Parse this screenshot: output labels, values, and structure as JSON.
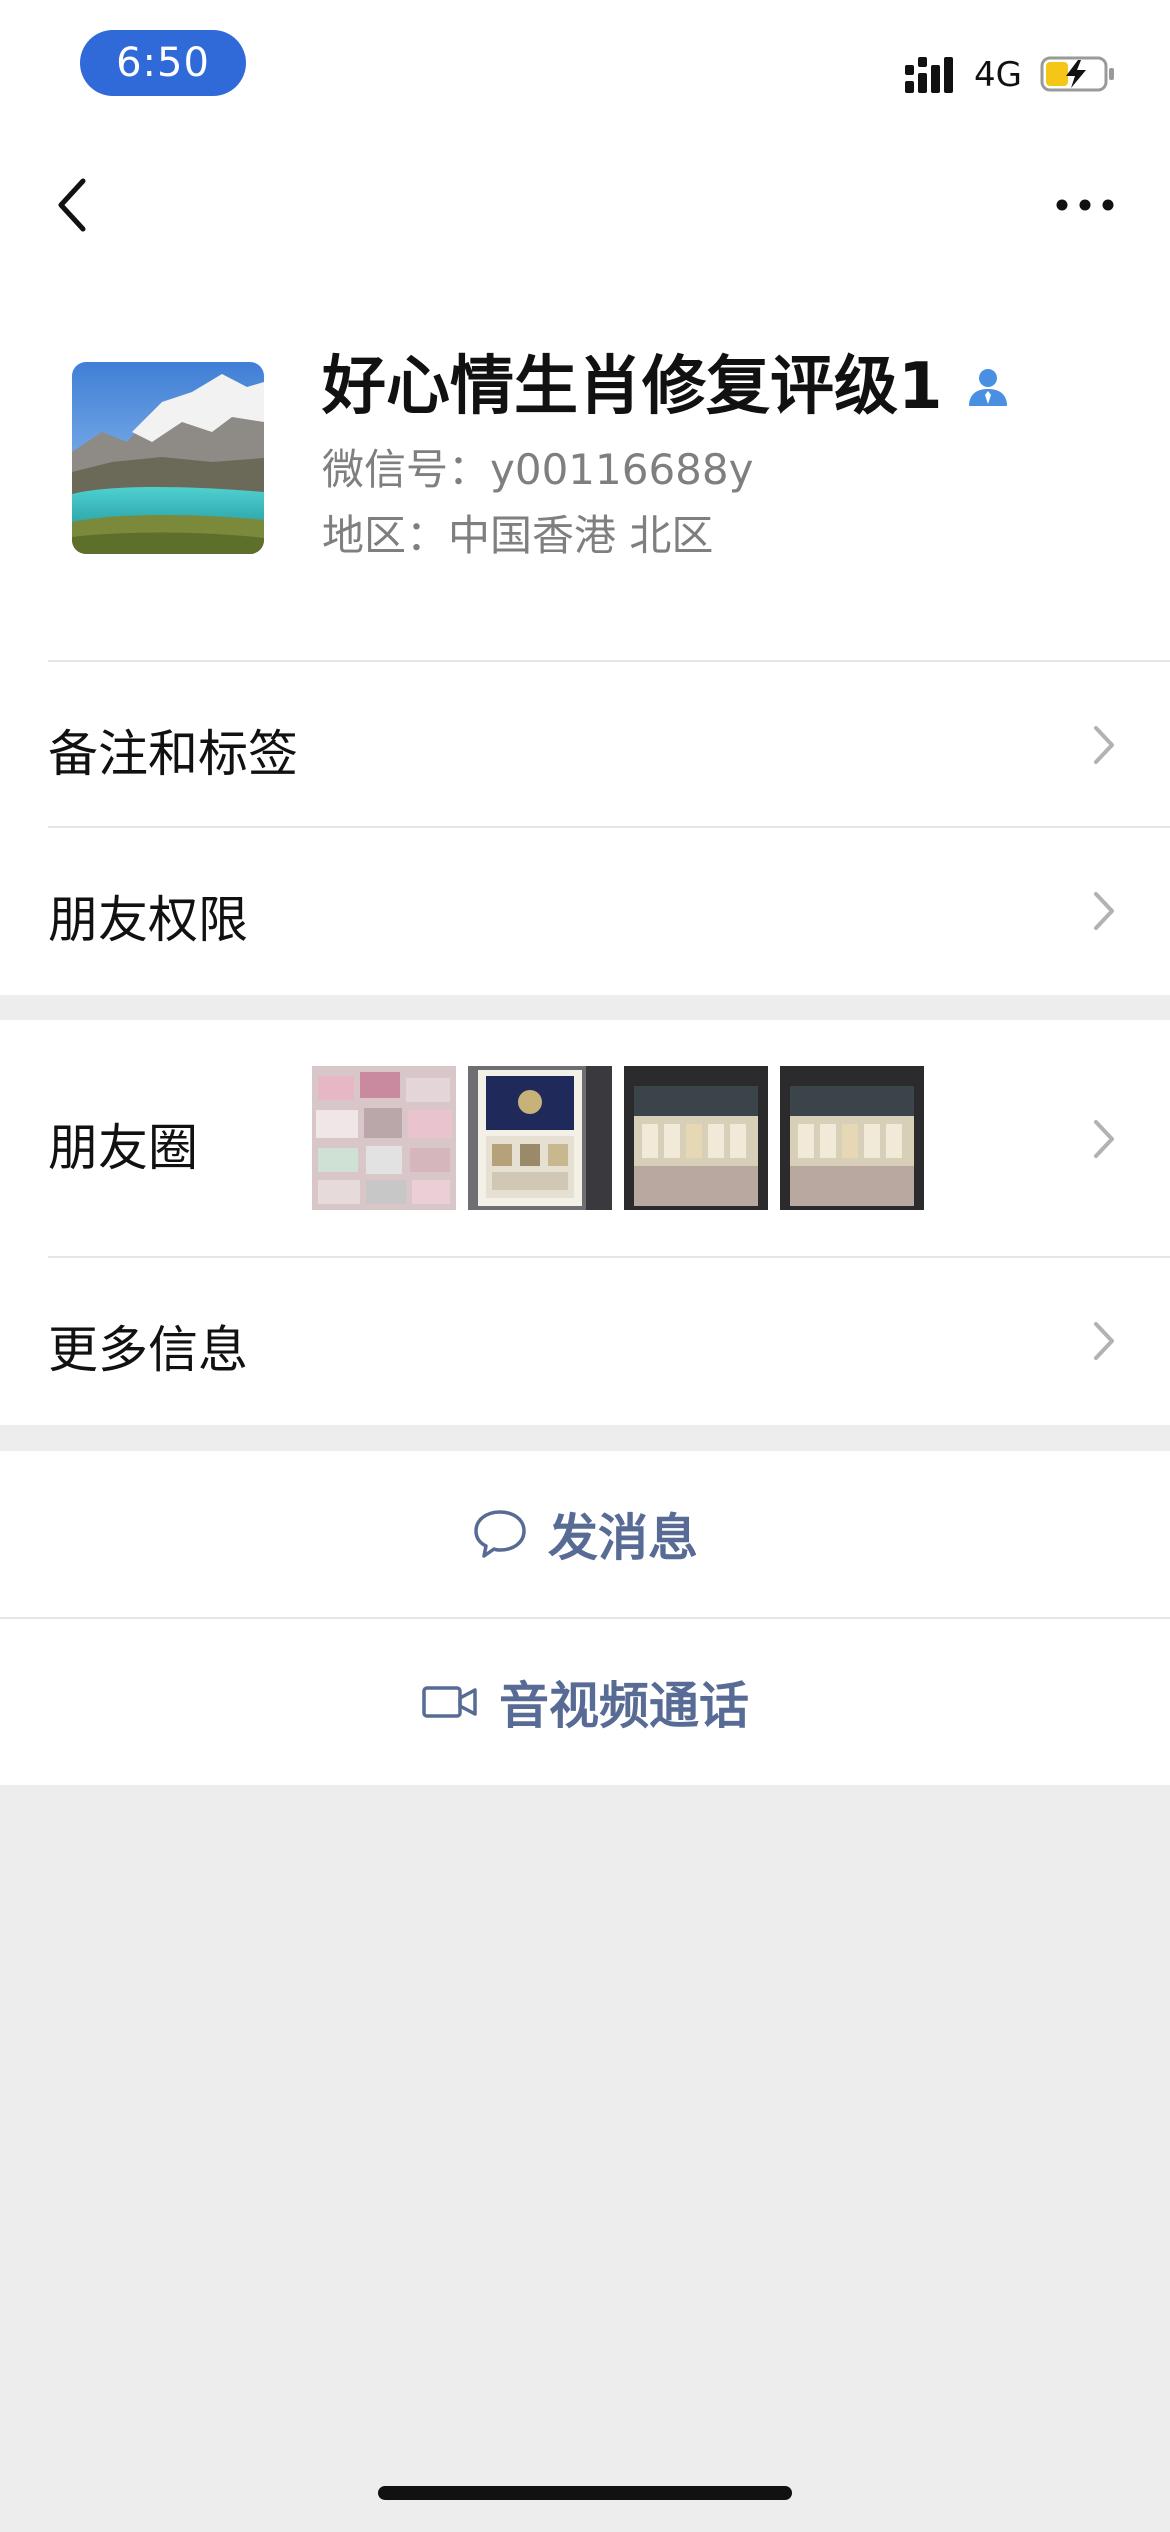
{
  "status_bar": {
    "time": "6:50",
    "network": "4G"
  },
  "nav": {
    "back_icon": "chevron-left-icon",
    "more_icon": "more-dots-icon"
  },
  "profile": {
    "name": "好心情生肖修复评级1",
    "wechat_id": "微信号：y00116688y",
    "region": "地区：中国香港 北区",
    "badge_icon": "contact-person-icon",
    "badge_color": "#4a90e2"
  },
  "rows": {
    "remarks_tags": "备注和标签",
    "friend_permissions": "朋友权限",
    "moments": "朋友圈",
    "more_info": "更多信息"
  },
  "actions": {
    "send_message": "发消息",
    "video_call": "音视频通话"
  },
  "colors": {
    "accent": "#576b95",
    "time_pill": "#2f6ad8",
    "background": "#ededed"
  }
}
